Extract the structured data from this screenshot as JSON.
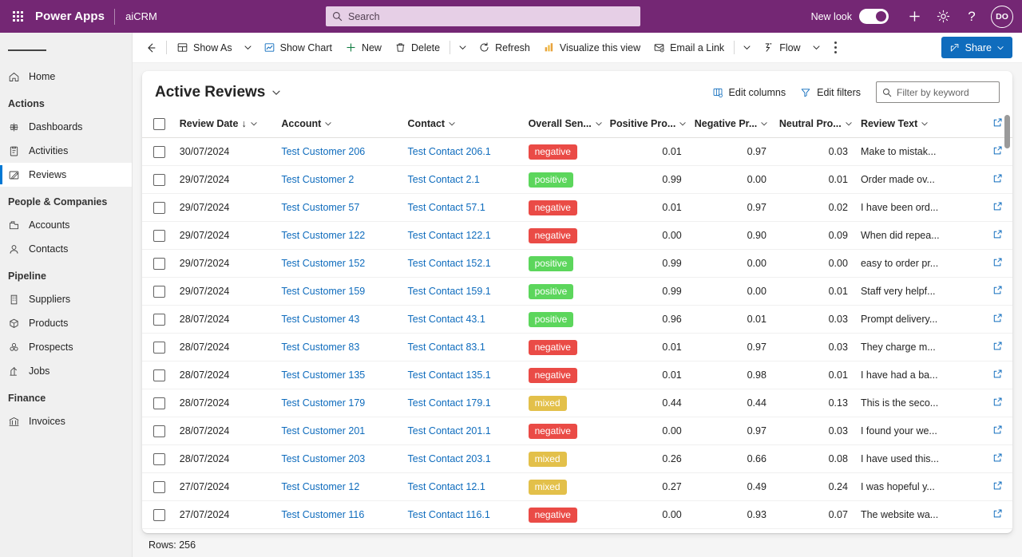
{
  "topbar": {
    "waffle_label": "app-launcher",
    "brand": "Power Apps",
    "app_name": "aiCRM",
    "search_placeholder": "Search",
    "search_value": "",
    "new_look_label": "New look",
    "new_look_on": true,
    "avatar_initials": "DO"
  },
  "sidebar": {
    "groups": [
      {
        "label": "",
        "items": [
          {
            "label": "Home",
            "icon": "home-icon",
            "active": false
          }
        ]
      },
      {
        "label": "Actions",
        "items": [
          {
            "label": "Dashboards",
            "icon": "dashboards-icon",
            "active": false
          },
          {
            "label": "Activities",
            "icon": "activities-icon",
            "active": false
          },
          {
            "label": "Reviews",
            "icon": "reviews-icon",
            "active": true
          }
        ]
      },
      {
        "label": "People & Companies",
        "items": [
          {
            "label": "Accounts",
            "icon": "accounts-icon",
            "active": false
          },
          {
            "label": "Contacts",
            "icon": "contacts-icon",
            "active": false
          }
        ]
      },
      {
        "label": "Pipeline",
        "items": [
          {
            "label": "Suppliers",
            "icon": "suppliers-icon",
            "active": false
          },
          {
            "label": "Products",
            "icon": "products-icon",
            "active": false
          },
          {
            "label": "Prospects",
            "icon": "prospects-icon",
            "active": false
          },
          {
            "label": "Jobs",
            "icon": "jobs-icon",
            "active": false
          }
        ]
      },
      {
        "label": "Finance",
        "items": [
          {
            "label": "Invoices",
            "icon": "invoices-icon",
            "active": false
          }
        ]
      }
    ]
  },
  "commandbar": {
    "back": "back-arrow",
    "show_as": "Show As",
    "show_chart": "Show Chart",
    "new": "New",
    "delete": "Delete",
    "refresh": "Refresh",
    "visualize": "Visualize this view",
    "email_link": "Email a Link",
    "flow": "Flow",
    "overflow": "more-commands",
    "share": "Share"
  },
  "view": {
    "title": "Active Reviews",
    "edit_columns": "Edit columns",
    "edit_filters": "Edit filters",
    "filter_placeholder": "Filter by keyword",
    "filter_value": ""
  },
  "table": {
    "columns": [
      {
        "label": "Review Date",
        "sorted": true,
        "sort_dir": "↓",
        "align": "left"
      },
      {
        "label": "Account",
        "align": "left"
      },
      {
        "label": "Contact",
        "align": "left"
      },
      {
        "label": "Overall Sen...",
        "align": "left"
      },
      {
        "label": "Positive Pro...",
        "align": "right"
      },
      {
        "label": "Negative Pr...",
        "align": "right"
      },
      {
        "label": "Neutral Pro...",
        "align": "right"
      },
      {
        "label": "Review Text",
        "align": "left"
      }
    ],
    "sentiment_colors": {
      "negative": "#ea4b46",
      "positive": "#5cd65c",
      "mixed": "#e3c04a"
    },
    "rows": [
      {
        "date": "30/07/2024",
        "account": "Test Customer 206",
        "contact": "Test Contact 206.1",
        "sentiment": "negative",
        "positive": "0.01",
        "negative": "0.97",
        "neutral": "0.03",
        "text": "Make to mistak..."
      },
      {
        "date": "29/07/2024",
        "account": "Test Customer 2",
        "contact": "Test Contact 2.1",
        "sentiment": "positive",
        "positive": "0.99",
        "negative": "0.00",
        "neutral": "0.01",
        "text": "Order made ov..."
      },
      {
        "date": "29/07/2024",
        "account": "Test Customer 57",
        "contact": "Test Contact 57.1",
        "sentiment": "negative",
        "positive": "0.01",
        "negative": "0.97",
        "neutral": "0.02",
        "text": "I have been ord..."
      },
      {
        "date": "29/07/2024",
        "account": "Test Customer 122",
        "contact": "Test Contact 122.1",
        "sentiment": "negative",
        "positive": "0.00",
        "negative": "0.90",
        "neutral": "0.09",
        "text": "When did repea..."
      },
      {
        "date": "29/07/2024",
        "account": "Test Customer 152",
        "contact": "Test Contact 152.1",
        "sentiment": "positive",
        "positive": "0.99",
        "negative": "0.00",
        "neutral": "0.00",
        "text": "easy to order pr..."
      },
      {
        "date": "29/07/2024",
        "account": "Test Customer 159",
        "contact": "Test Contact 159.1",
        "sentiment": "positive",
        "positive": "0.99",
        "negative": "0.00",
        "neutral": "0.01",
        "text": "Staff very helpf..."
      },
      {
        "date": "28/07/2024",
        "account": "Test Customer 43",
        "contact": "Test Contact 43.1",
        "sentiment": "positive",
        "positive": "0.96",
        "negative": "0.01",
        "neutral": "0.03",
        "text": "Prompt delivery..."
      },
      {
        "date": "28/07/2024",
        "account": "Test Customer 83",
        "contact": "Test Contact 83.1",
        "sentiment": "negative",
        "positive": "0.01",
        "negative": "0.97",
        "neutral": "0.03",
        "text": "They charge m..."
      },
      {
        "date": "28/07/2024",
        "account": "Test Customer 135",
        "contact": "Test Contact 135.1",
        "sentiment": "negative",
        "positive": "0.01",
        "negative": "0.98",
        "neutral": "0.01",
        "text": "I have had a ba..."
      },
      {
        "date": "28/07/2024",
        "account": "Test Customer 179",
        "contact": "Test Contact 179.1",
        "sentiment": "mixed",
        "positive": "0.44",
        "negative": "0.44",
        "neutral": "0.13",
        "text": "This is the seco..."
      },
      {
        "date": "28/07/2024",
        "account": "Test Customer 201",
        "contact": "Test Contact 201.1",
        "sentiment": "negative",
        "positive": "0.00",
        "negative": "0.97",
        "neutral": "0.03",
        "text": "I found your we..."
      },
      {
        "date": "28/07/2024",
        "account": "Test Customer 203",
        "contact": "Test Contact 203.1",
        "sentiment": "mixed",
        "positive": "0.26",
        "negative": "0.66",
        "neutral": "0.08",
        "text": "I have used this..."
      },
      {
        "date": "27/07/2024",
        "account": "Test Customer 12",
        "contact": "Test Contact 12.1",
        "sentiment": "mixed",
        "positive": "0.27",
        "negative": "0.49",
        "neutral": "0.24",
        "text": "I was hopeful y..."
      },
      {
        "date": "27/07/2024",
        "account": "Test Customer 116",
        "contact": "Test Contact 116.1",
        "sentiment": "negative",
        "positive": "0.00",
        "negative": "0.93",
        "neutral": "0.07",
        "text": "The website wa..."
      }
    ]
  },
  "status": {
    "rows_label": "Rows: 256"
  }
}
